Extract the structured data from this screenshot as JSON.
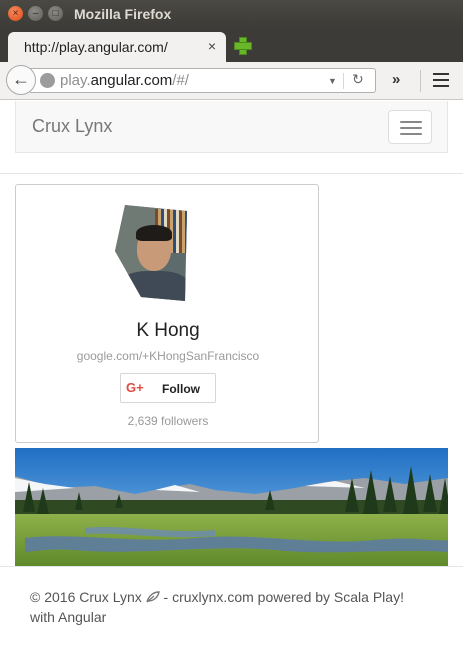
{
  "window": {
    "title": "Mozilla Firefox",
    "close_glyph": "×",
    "minimize_glyph": "–",
    "maximize_glyph": "□"
  },
  "tabs": [
    {
      "label": "http://play.angular.com/",
      "close_glyph": "×",
      "active": true
    }
  ],
  "toolbar": {
    "back_glyph": "←",
    "url_prefix": "play.",
    "url_host": "angular.com",
    "url_suffix": "/#/",
    "dropdown_glyph": "▼",
    "reload_glyph": "↻",
    "overflow_glyph": "»"
  },
  "site": {
    "brand": "Crux Lynx",
    "profile": {
      "name": "K Hong",
      "url": "google.com/+KHongSanFrancisco",
      "gplus_mark": "G+",
      "follow_label": "Follow",
      "followers": "2,639 followers"
    },
    "footer": {
      "text_before": "© 2016 Crux Lynx",
      "text_after": " - cruxlynx.com powered by Scala Play! with Angular"
    }
  },
  "icons": {
    "back": "back-arrow-icon",
    "globe": "globe-icon",
    "reload": "reload-icon",
    "menu": "hamburger-menu-icon",
    "new_tab": "plus-icon",
    "leaf": "leaf-icon"
  },
  "colors": {
    "titlebar": "#3c3b37",
    "close_button": "#df4a16",
    "new_tab_plus": "#6ab62b",
    "gplus_red": "#dc4e41",
    "navbar_bg": "#f8f8f8"
  }
}
